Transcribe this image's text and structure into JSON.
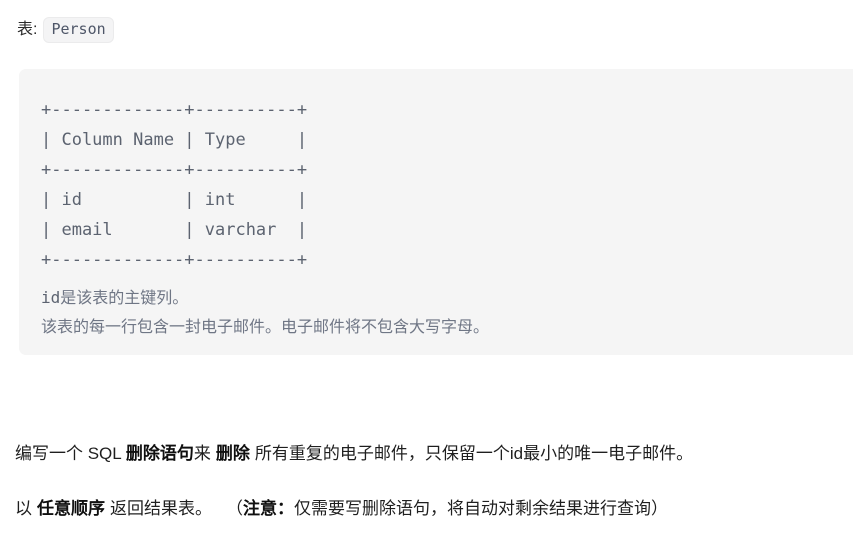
{
  "header": {
    "label": "表:",
    "table_name": "Person"
  },
  "code_block": {
    "ascii_table": {
      "separator": "+-------------+----------+",
      "header_row": "| Column Name | Type     |",
      "rows": [
        "| id          | int      |",
        "| email       | varchar  |"
      ],
      "columns": [
        "Column Name",
        "Type"
      ],
      "data": [
        {
          "column_name": "id",
          "type": "int"
        },
        {
          "column_name": "email",
          "type": "varchar"
        }
      ]
    },
    "notes": [
      {
        "mono": "id",
        "rest": "是该表的主键列。"
      },
      {
        "text": "该表的每一行包含一封电子邮件。电子邮件将不包含大写字母。"
      }
    ]
  },
  "paragraphs": {
    "p1": {
      "part1": "编写一个 SQL ",
      "bold1": "删除语句",
      "part2": "来",
      "bold2": "删除",
      "part3": "所有重复的电子邮件，只保留一个id最小的唯一电子邮件。"
    },
    "p2": {
      "part1": "以",
      "bold1": "任意顺序",
      "part2": "返回结果表。",
      "paren_open": "（",
      "bold2": "注意：",
      "part3": "仅需要写删除语句，将自动对剩余结果进行查询）"
    }
  },
  "colors": {
    "code_block_bg": "#f5f5f5",
    "code_text": "#5c6370",
    "pipe_accent": "#c48a3f",
    "note_text": "#6f7685",
    "body_text": "#1f1f1f",
    "badge_bg": "#f4f4f5"
  }
}
